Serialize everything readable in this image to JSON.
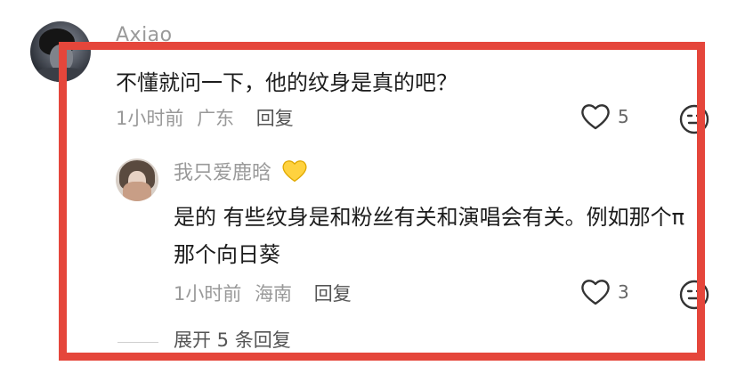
{
  "colors": {
    "highlight_border": "#e5463b",
    "username": "#9a9a9a",
    "meta": "#999999"
  },
  "comment": {
    "username": "Axiao",
    "text": "不懂就问一下，他的纹身是真的吧？",
    "time": "1小时前",
    "location": "广东",
    "reply_label": "回复",
    "like_count": "5",
    "avatar_icon": "user-avatar",
    "like_icon": "heart-outline-icon",
    "emoji_icon": "emoji-face-icon"
  },
  "reply": {
    "username": "我只爱鹿晗",
    "badge_icon": "yellow-heart-icon",
    "text": "是的 有些纹身是和粉丝有关和演唱会有关。例如那个π 那个向日葵",
    "time": "1小时前",
    "location": "海南",
    "reply_label": "回复",
    "like_count": "3",
    "avatar_icon": "user-avatar",
    "like_icon": "heart-outline-icon",
    "emoji_icon": "emoji-face-icon"
  },
  "expand_replies": {
    "label": "展开 5 条回复"
  }
}
